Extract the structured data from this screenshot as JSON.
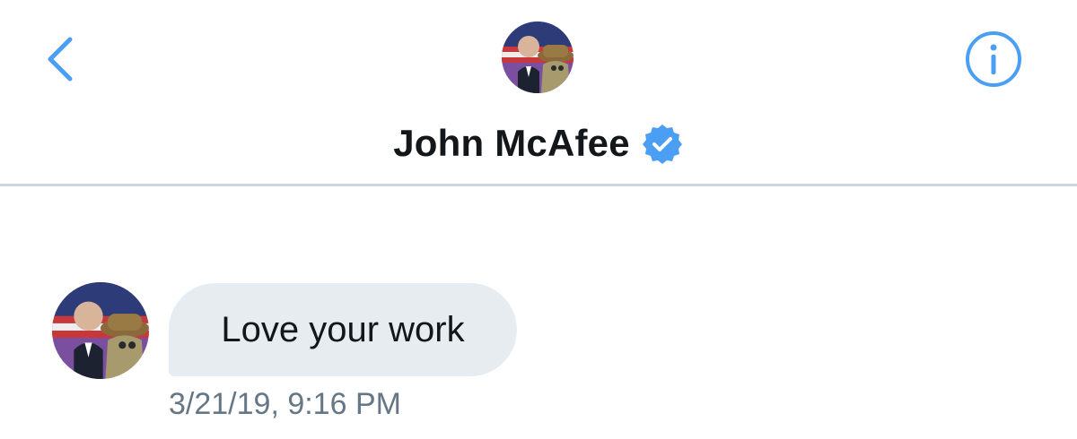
{
  "header": {
    "back_icon": "chevron-left-icon",
    "info_icon": "info-icon",
    "contact_name": "John McAfee",
    "verified_icon": "verified-badge-icon",
    "accent_color": "#4a9ff5"
  },
  "conversation": {
    "messages": [
      {
        "text": "Love your work",
        "timestamp": "3/21/19, 9:16 PM"
      }
    ]
  },
  "colors": {
    "bubble_bg": "#e6ecf0",
    "text": "#14171a",
    "muted_text": "#657786",
    "divider": "#ccd6dd"
  }
}
